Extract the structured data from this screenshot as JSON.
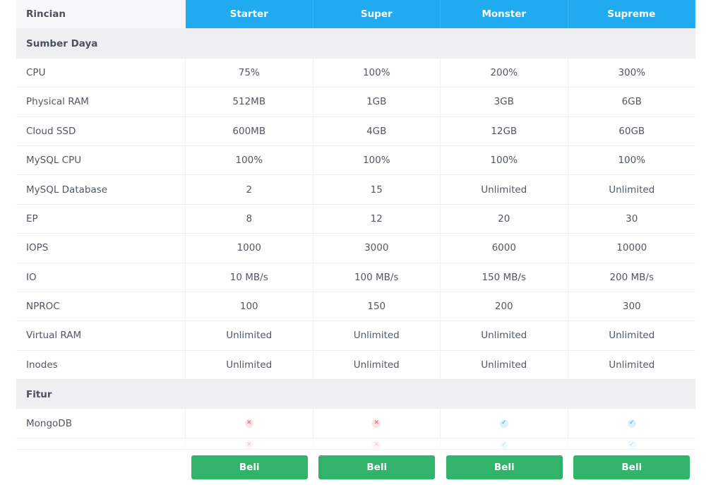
{
  "header": {
    "label": "Rincian",
    "plans": [
      "Starter",
      "Super",
      "Monster",
      "Supreme"
    ]
  },
  "sections": {
    "resources_title": "Sumber Daya",
    "features_title": "Fitur"
  },
  "rows": [
    {
      "label": "CPU",
      "values": [
        "75%",
        "100%",
        "200%",
        "300%"
      ]
    },
    {
      "label": "Physical RAM",
      "values": [
        "512MB",
        "1GB",
        "3GB",
        "6GB"
      ]
    },
    {
      "label": "Cloud SSD",
      "values": [
        "600MB",
        "4GB",
        "12GB",
        "60GB"
      ]
    },
    {
      "label": "MySQL CPU",
      "values": [
        "100%",
        "100%",
        "100%",
        "100%"
      ]
    },
    {
      "label": "MySQL Database",
      "values": [
        "2",
        "15",
        "Unlimited",
        "Unlimited"
      ]
    },
    {
      "label": "EP",
      "values": [
        "8",
        "12",
        "20",
        "30"
      ]
    },
    {
      "label": "IOPS",
      "values": [
        "1000",
        "3000",
        "6000",
        "10000"
      ]
    },
    {
      "label": "IO",
      "values": [
        "10 MB/s",
        "100 MB/s",
        "150 MB/s",
        "200 MB/s"
      ]
    },
    {
      "label": "NPROC",
      "values": [
        "100",
        "150",
        "200",
        "300"
      ]
    },
    {
      "label": "Virtual RAM",
      "values": [
        "Unlimited",
        "Unlimited",
        "Unlimited",
        "Unlimited"
      ]
    },
    {
      "label": "Inodes",
      "values": [
        "Unlimited",
        "Unlimited",
        "Unlimited",
        "Unlimited"
      ]
    }
  ],
  "features": [
    {
      "label": "MongoDB",
      "values": [
        "x-icon",
        "x-icon",
        "check-icon",
        "check-icon"
      ]
    }
  ],
  "footer": {
    "button_label": "Beli"
  },
  "colors": {
    "header_accent": "#20aaf0",
    "buy_button": "#31b36b",
    "unavailable": "#e35d66",
    "available": "#2ea3e0"
  }
}
